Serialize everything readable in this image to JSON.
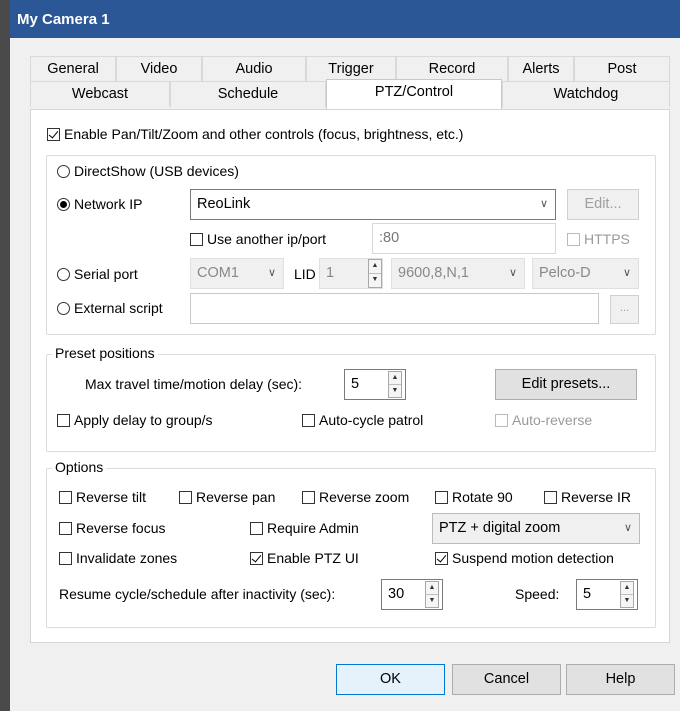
{
  "window": {
    "title": "My Camera 1"
  },
  "tabs_row1": [
    "General",
    "Video",
    "Audio",
    "Trigger",
    "Record",
    "Alerts",
    "Post"
  ],
  "tabs_row2": [
    "Webcast",
    "Schedule",
    "PTZ/Control",
    "Watchdog"
  ],
  "enable_ptz": {
    "label": "Enable Pan/Tilt/Zoom and other controls (focus, brightness, etc.)",
    "checked": true
  },
  "source": {
    "directshow": "DirectShow (USB devices)",
    "network_ip": "Network IP",
    "network_value": "ReoLink",
    "edit_button": "Edit...",
    "use_another": "Use another ip/port",
    "port_value": ":80",
    "https": "HTTPS",
    "serial_port": "Serial port",
    "com_value": "COM1",
    "lid_label": "LID",
    "lid_value": "1",
    "baud_value": "9600,8,N,1",
    "protocol_value": "Pelco-D",
    "external_script": "External script",
    "browse_button": "..."
  },
  "presets": {
    "group_label": "Preset positions",
    "max_travel_label": "Max travel time/motion delay (sec):",
    "max_travel_value": "5",
    "edit_presets_button": "Edit presets...",
    "apply_delay": "Apply delay to group/s",
    "auto_cycle": "Auto-cycle patrol",
    "auto_reverse": "Auto-reverse"
  },
  "options": {
    "group_label": "Options",
    "reverse_tilt": "Reverse tilt",
    "reverse_pan": "Reverse pan",
    "reverse_zoom": "Reverse zoom",
    "rotate_90": "Rotate 90",
    "reverse_ir": "Reverse IR",
    "reverse_focus": "Reverse focus",
    "require_admin": "Require Admin",
    "zoom_mode": "PTZ + digital zoom",
    "invalidate_zones": "Invalidate zones",
    "enable_ptz_ui": "Enable PTZ UI",
    "suspend_motion": "Suspend motion detection",
    "resume_label": "Resume cycle/schedule after inactivity (sec):",
    "resume_value": "30",
    "speed_label": "Speed:",
    "speed_value": "5"
  },
  "buttons": {
    "ok": "OK",
    "cancel": "Cancel",
    "help": "Help"
  },
  "colors": {
    "titlebar": "#2b5797",
    "primary_border": "#0078d7"
  }
}
